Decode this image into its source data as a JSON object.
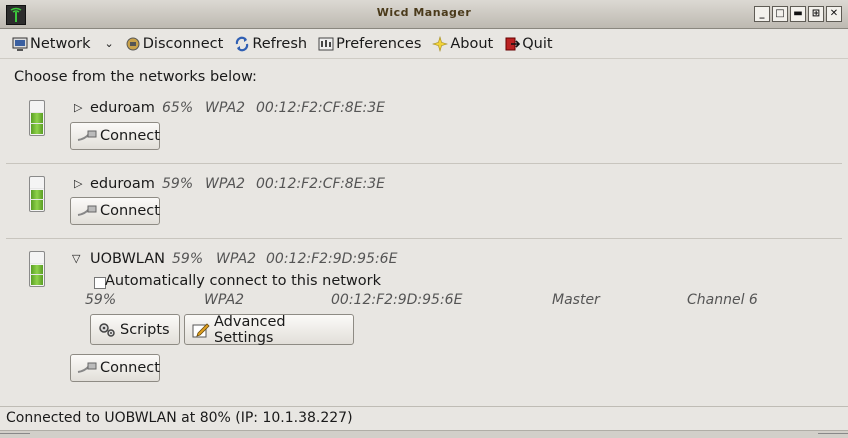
{
  "window": {
    "title": "Wicd Manager",
    "controls": [
      "_",
      "□",
      "▬",
      "⊞",
      "✕"
    ]
  },
  "toolbar": {
    "network_label": "Network",
    "disconnect_label": "Disconnect",
    "refresh_label": "Refresh",
    "preferences_label": "Preferences",
    "about_label": "About",
    "quit_label": "Quit"
  },
  "main": {
    "heading": "Choose from the networks below:",
    "networks": [
      {
        "essid": "eduroam",
        "strength": "65%",
        "strength_value": 0.65,
        "encryption": "WPA2",
        "bssid": "00:12:F2:CF:8E:3E",
        "expanded": false,
        "connect_label": "Connect"
      },
      {
        "essid": "eduroam",
        "strength": "59%",
        "strength_value": 0.59,
        "encryption": "WPA2",
        "bssid": "00:12:F2:CF:8E:3E",
        "expanded": false,
        "connect_label": "Connect"
      },
      {
        "essid": "UOBWLAN",
        "strength": "59%",
        "strength_value": 0.59,
        "encryption": "WPA2",
        "bssid": "00:12:F2:9D:95:6E",
        "expanded": true,
        "auto_connect_label": "Automatically connect to this network",
        "auto_connect_checked": false,
        "details": {
          "strength": "59%",
          "encryption": "WPA2",
          "bssid": "00:12:F2:9D:95:6E",
          "mode": "Master",
          "channel": "Channel 6"
        },
        "scripts_label": "Scripts",
        "advanced_label": "Advanced Settings",
        "connect_label": "Connect"
      }
    ]
  },
  "status": {
    "text": "Connected to UOBWLAN at 80% (IP: 10.1.38.227)"
  },
  "colors": {
    "window_bg": "#e8e6e2",
    "signal_green": "#7cc13a",
    "title_text": "#4a3a1a"
  },
  "icons": {
    "network": "network-monitor-icon",
    "disconnect": "unplug-icon",
    "refresh": "refresh-arrows-icon",
    "preferences": "preferences-panel-icon",
    "about": "star-icon",
    "quit": "exit-door-icon",
    "connect": "plug-cable-icon",
    "scripts": "gears-icon",
    "advanced": "edit-pencil-icon"
  }
}
